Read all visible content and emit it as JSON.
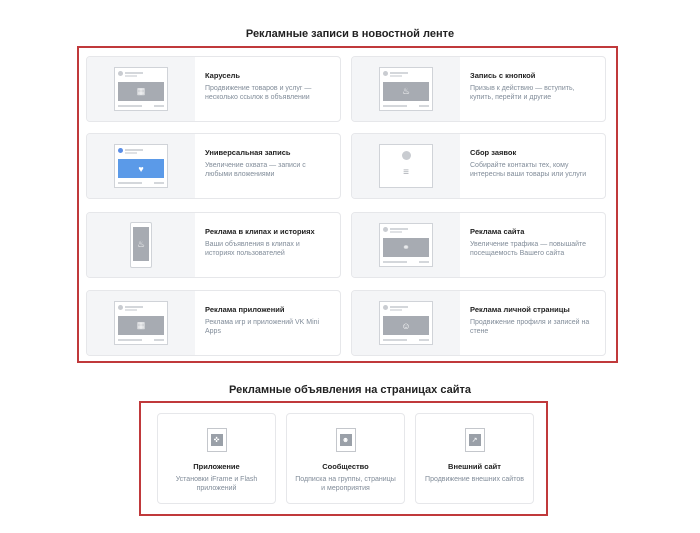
{
  "feed_section": {
    "title": "Рекламные записи в новостной ленте",
    "cards": [
      {
        "title": "Карусель",
        "desc": "Продвижение товаров и услуг — несколько ссылок в объявлении",
        "icon": "carousel-icon",
        "glyph": "▦"
      },
      {
        "title": "Запись с кнопкой",
        "desc": "Призыв к действию — вступить, купить, перейти и другие",
        "icon": "fire-icon",
        "glyph": "♨"
      },
      {
        "title": "Универсальная запись",
        "desc": "Увеличение охвата — записи с любыми вложениями",
        "icon": "heart-icon",
        "glyph": "♥"
      },
      {
        "title": "Сбор заявок",
        "desc": "Собирайте контакты тех, кому интересны ваши товары или услуги",
        "icon": "form-icon",
        "glyph": "≡"
      },
      {
        "title": "Реклама в клипах и историях",
        "desc": "Ваши объявления в клипах и историях пользователей",
        "icon": "phone-fire-icon",
        "glyph": "♨"
      },
      {
        "title": "Реклама сайта",
        "desc": "Увеличение трафика — повышайте посещаемость Вашего сайта",
        "icon": "link-icon",
        "glyph": "⚭"
      },
      {
        "title": "Реклама приложений",
        "desc": "Реклама игр и приложений VK Mini Apps",
        "icon": "apps-grid-icon",
        "glyph": "▦"
      },
      {
        "title": "Реклама личной страницы",
        "desc": "Продвижение профиля и записей на стене",
        "icon": "person-icon",
        "glyph": "☺"
      }
    ]
  },
  "site_section": {
    "title": "Рекламные объявления на страницах сайта",
    "cards": [
      {
        "title": "Приложение",
        "desc": "Установки iFrame и Flash приложений",
        "icon": "gamepad-icon",
        "glyph": "✜"
      },
      {
        "title": "Сообщество",
        "desc": "Подписка на группы, страницы и мероприятия",
        "icon": "community-icon",
        "glyph": "☻"
      },
      {
        "title": "Внешний сайт",
        "desc": "Продвижение внешних сайтов",
        "icon": "external-link-icon",
        "glyph": "↗"
      }
    ]
  },
  "colors": {
    "frame": "#c0393b",
    "thumb_bg": "#f4f5f7",
    "desc": "#818c99"
  }
}
